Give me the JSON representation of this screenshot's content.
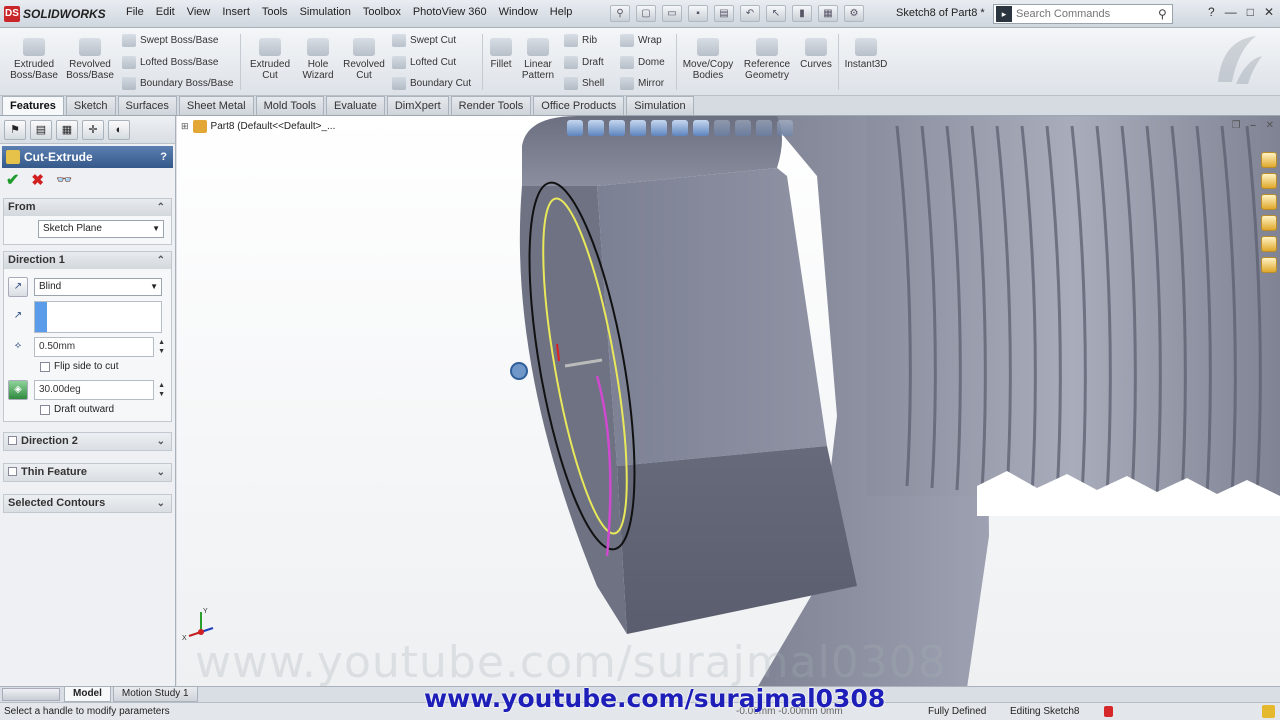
{
  "app": {
    "name": "SOLIDWORKS",
    "doc_title": "Sketch8 of Part8 *"
  },
  "menu": [
    "File",
    "Edit",
    "View",
    "Insert",
    "Tools",
    "Simulation",
    "Toolbox",
    "PhotoView 360",
    "Window",
    "Help"
  ],
  "search": {
    "placeholder": "Search Commands"
  },
  "command_manager": {
    "extruded_boss": "Extruded Boss/Base",
    "revolved_boss": "Revolved Boss/Base",
    "swept_boss": "Swept Boss/Base",
    "lofted_boss": "Lofted Boss/Base",
    "boundary_boss": "Boundary Boss/Base",
    "extruded_cut": "Extruded Cut",
    "hole_wizard": "Hole Wizard",
    "revolved_cut": "Revolved Cut",
    "swept_cut": "Swept Cut",
    "lofted_cut": "Lofted Cut",
    "boundary_cut": "Boundary Cut",
    "fillet": "Fillet",
    "linear_pattern": "Linear Pattern",
    "rib": "Rib",
    "draft": "Draft",
    "shell": "Shell",
    "wrap": "Wrap",
    "dome": "Dome",
    "mirror": "Mirror",
    "move_copy": "Move/Copy Bodies",
    "reference_geometry": "Reference Geometry",
    "curves": "Curves",
    "instant3d": "Instant3D"
  },
  "tabs": [
    "Features",
    "Sketch",
    "Surfaces",
    "Sheet Metal",
    "Mold Tools",
    "Evaluate",
    "DimXpert",
    "Render Tools",
    "Office Products",
    "Simulation"
  ],
  "active_tab": "Features",
  "property_manager": {
    "title": "Cut-Extrude",
    "help": "?",
    "from": {
      "label": "From",
      "value": "Sketch Plane"
    },
    "direction1": {
      "label": "Direction 1",
      "end_condition": "Blind",
      "depth": "0.50mm",
      "flip_side": "Flip side to cut",
      "draft_angle": "30.00deg",
      "draft_outward": "Draft outward"
    },
    "direction2": "Direction 2",
    "thin_feature": "Thin Feature",
    "selected_contours": "Selected Contours"
  },
  "tree_root": "Part8  (Default<<Default>_...",
  "viewport_watermark": "www.youtube.com/surajmal0308",
  "triad_labels": {
    "y": "Y",
    "x": "X"
  },
  "bottom_tabs": [
    "Model",
    "Motion Study 1"
  ],
  "status": {
    "message": "Select a handle to modify parameters",
    "coords": "-0.00mm   -0.00mm  0mm",
    "definition": "Fully Defined",
    "editing": "Editing Sketch8"
  },
  "banner": "www.youtube.com/surajmal0308",
  "colors": {
    "accent": "#35598a",
    "ok": "#1f9b2c",
    "cancel": "#d02020",
    "banner": "#1e1eb8",
    "preview": "#e8e85a"
  }
}
